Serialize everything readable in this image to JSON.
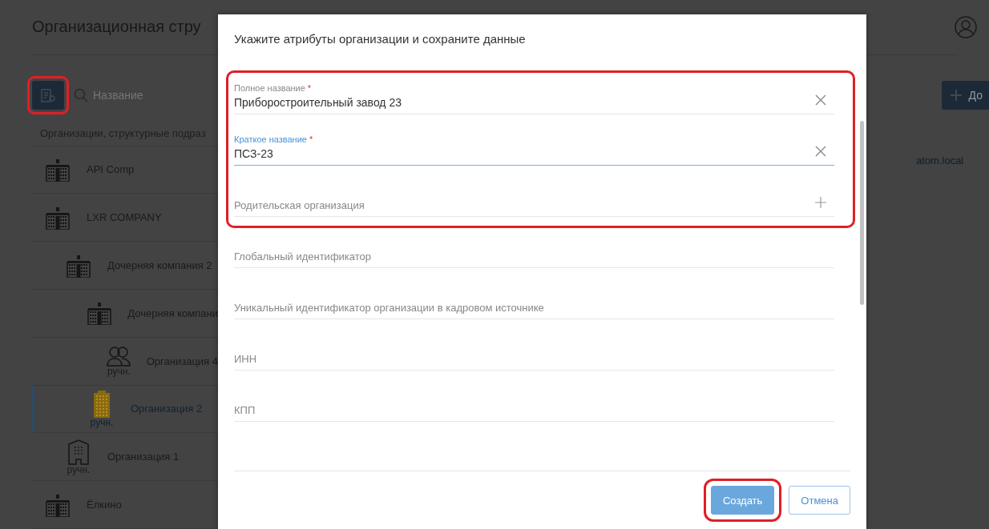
{
  "page": {
    "title": "Организационная стру",
    "search": {
      "placeholder": "Название"
    },
    "list_header": "Организации, структурные подраз",
    "tree": [
      {
        "name": "API Comp",
        "kind": "classic",
        "selected": false
      },
      {
        "name": "LXR COMPANY",
        "kind": "classic",
        "selected": false,
        "children": [
          {
            "name": "Дочерняя компания 2",
            "kind": "classic",
            "selected": false,
            "children": [
              {
                "name": "Дочерняя компани",
                "kind": "classic",
                "selected": false,
                "children": [
                  {
                    "name": "Организация 4",
                    "kind": "group",
                    "tag": "ручн.",
                    "selected": false
                  }
                ]
              },
              {
                "name": "Организация 2",
                "kind": "tower",
                "tag": "ручн.",
                "selected": true
              }
            ]
          },
          {
            "name": "Организация 1",
            "kind": "office",
            "tag": "ручн.",
            "selected": false
          }
        ]
      },
      {
        "name": "Ёлкино",
        "kind": "classic",
        "selected": false
      }
    ],
    "add_button": "До",
    "detail_value": "atom.local"
  },
  "dialog": {
    "title": "Укажите атрибуты организации и сохраните данные",
    "fields": [
      {
        "kind": "text",
        "label": "Полное название",
        "required_mark": "*",
        "value": "Приборостроительный завод 23",
        "focused": false
      },
      {
        "kind": "text",
        "label": "Краткое название",
        "required_mark": "*",
        "value": "ПСЗ-23",
        "focused": true
      },
      {
        "kind": "picker",
        "label": "Родительская организация",
        "focused": false
      },
      {
        "kind": "text",
        "label": "Глобальный идентификатор",
        "focused": false
      },
      {
        "kind": "text",
        "label": "Уникальный идентификатор организации в кадровом источнике",
        "focused": false
      },
      {
        "kind": "text",
        "label": "ИНН",
        "focused": false
      },
      {
        "kind": "text",
        "label": "КПП",
        "focused": false
      }
    ],
    "buttons": [
      {
        "label": "Создать",
        "kind": "primary"
      },
      {
        "label": "Отмена",
        "kind": "secondary"
      }
    ]
  }
}
